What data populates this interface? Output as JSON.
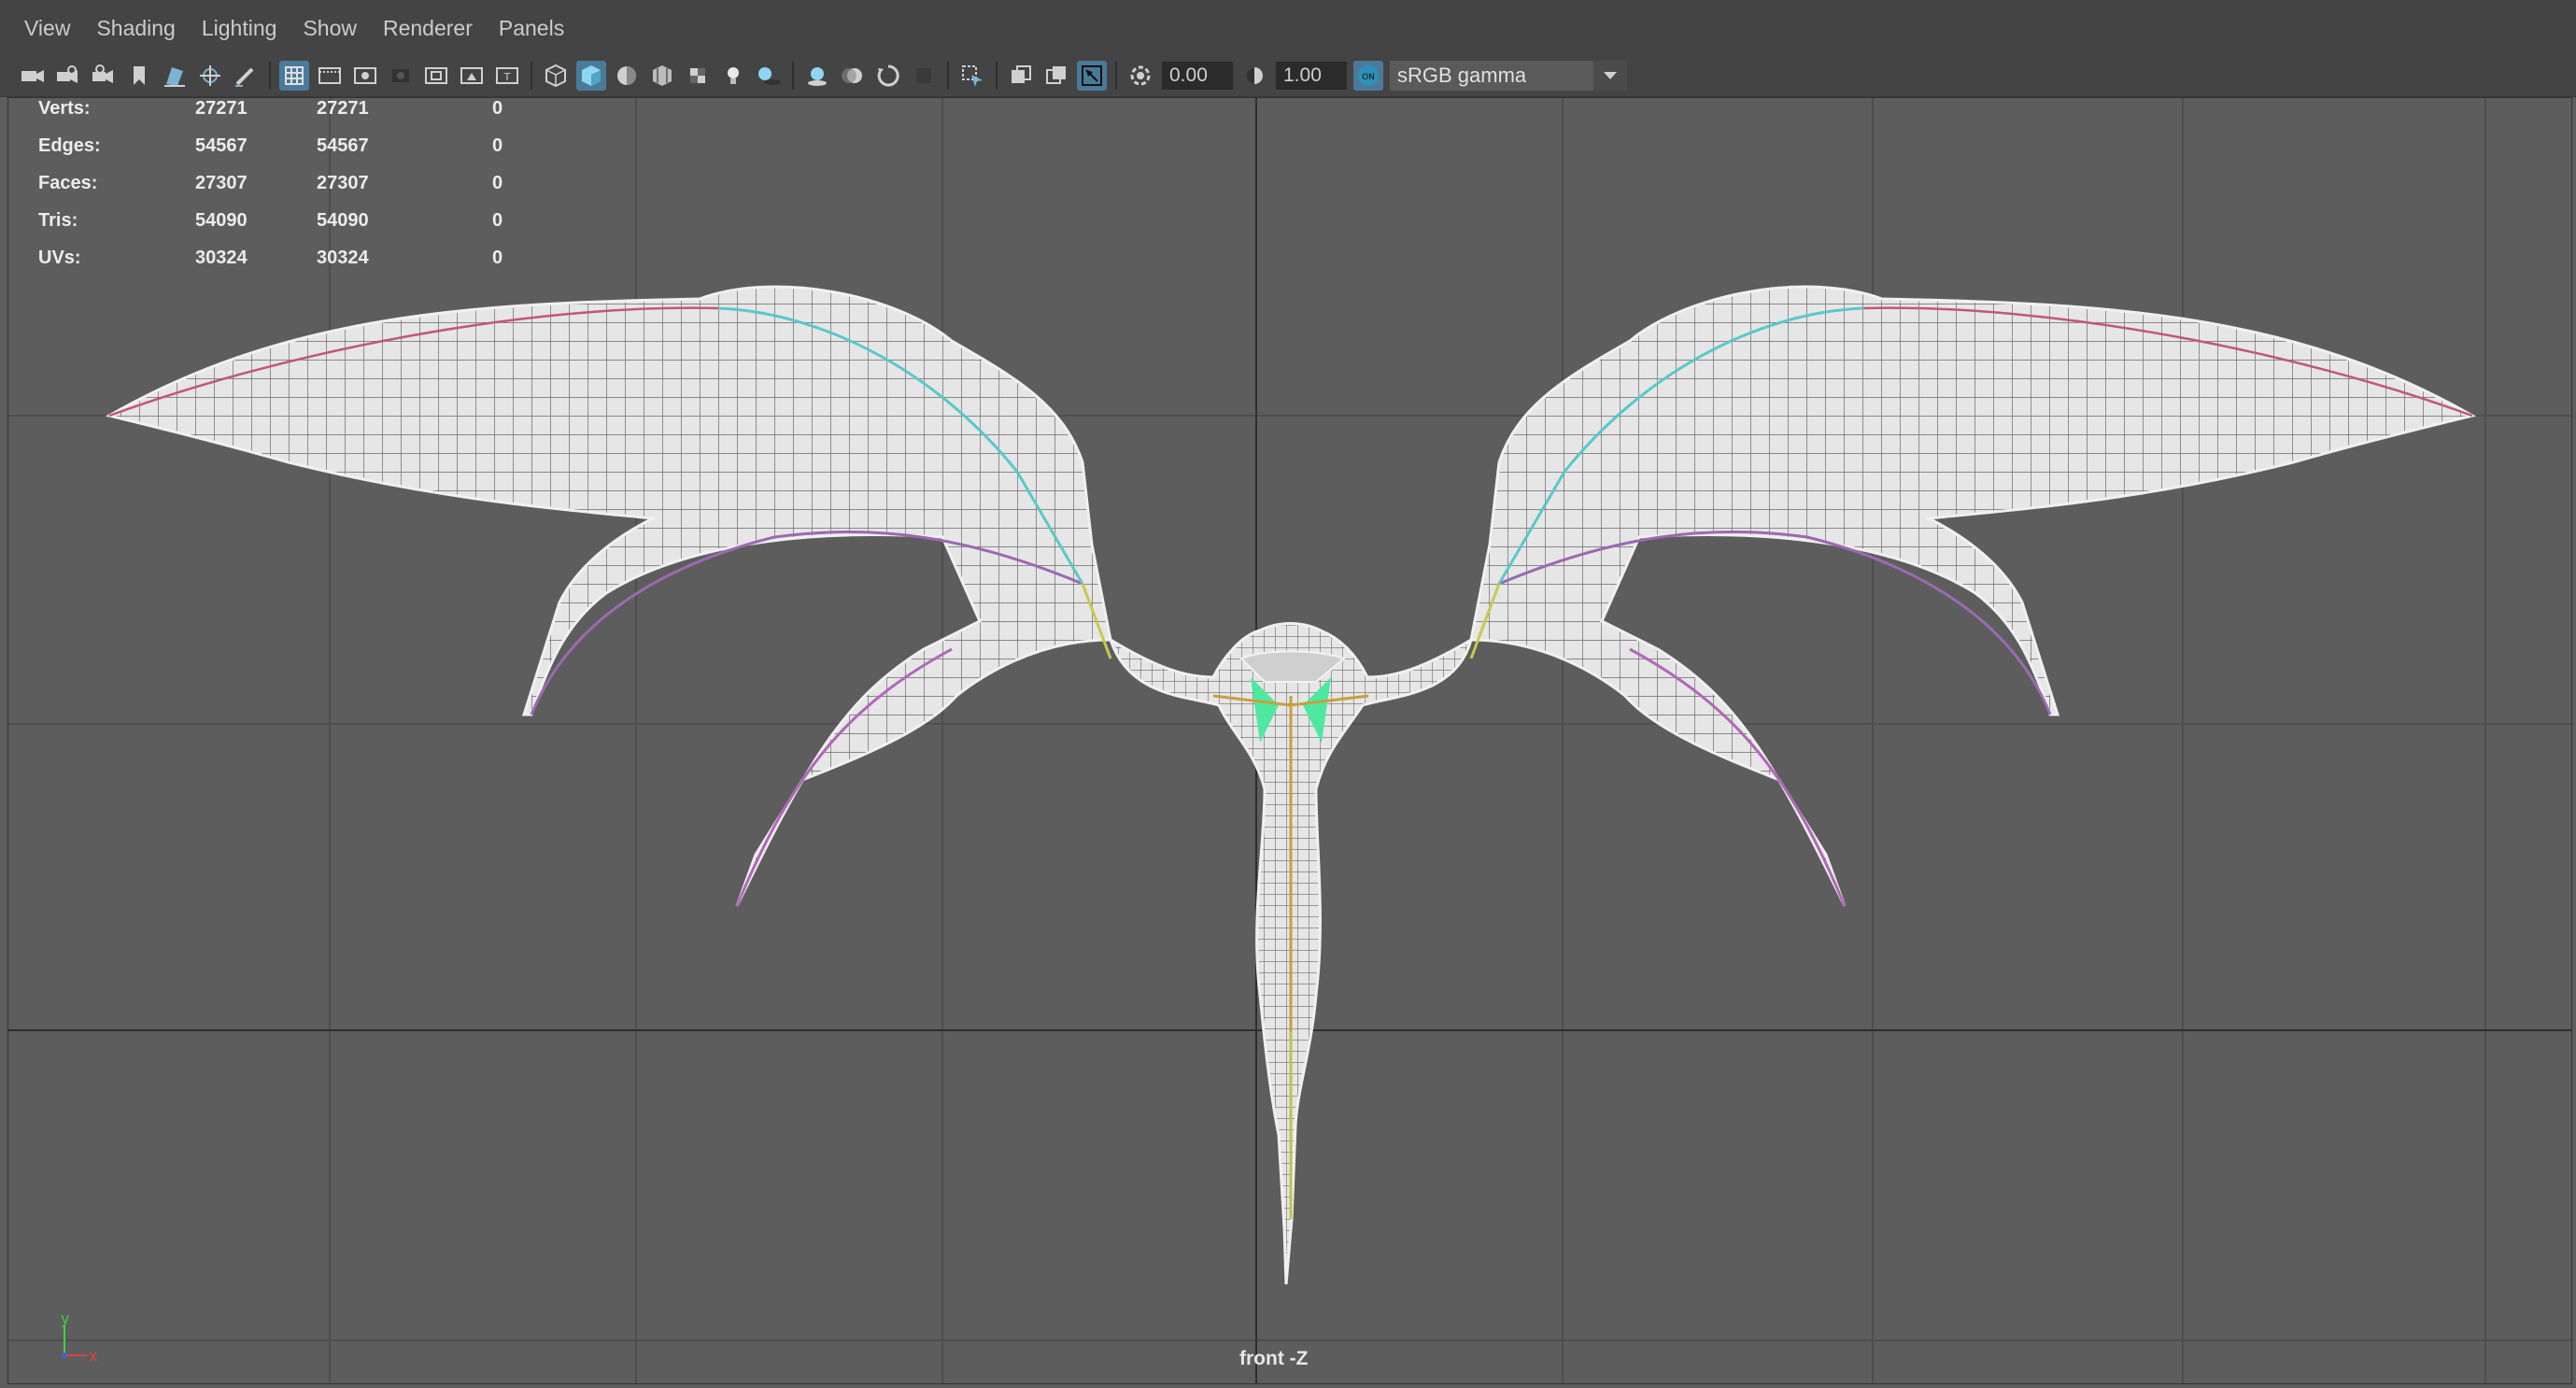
{
  "menu": [
    "View",
    "Shading",
    "Lighting",
    "Show",
    "Renderer",
    "Panels"
  ],
  "toolbar": {
    "exposure_value": "0.00",
    "gamma_value": "1.00",
    "color_space": "sRGB gamma",
    "icons": [
      "camera-icon",
      "camera-attributes-icon",
      "bookmark-icon",
      "image-plane-icon",
      "pan-zoom-icon",
      "grease-pencil-icon",
      "grid-icon",
      "film-gate-icon",
      "resolution-gate-icon",
      "gate-mask-icon",
      "field-chart-icon",
      "safe-action-icon",
      "safe-title-icon",
      "wireframe-icon",
      "smooth-shade-icon",
      "default-material-icon",
      "textured-icon",
      "lights-icon",
      "shadows-icon",
      "screen-space-ao-icon",
      "motion-blur-icon",
      "anti-alias-icon",
      "isolate-select-icon",
      "xray-icon",
      "xray-active-icon",
      "xray-joints-icon",
      "exposure-icon",
      "gamma-icon",
      "color-management-icon"
    ],
    "accent": "#4a7a9a"
  },
  "hud": {
    "rows": [
      {
        "label": "Verts:",
        "total": "27271",
        "selected": "27271",
        "extra": "0"
      },
      {
        "label": "Edges:",
        "total": "54567",
        "selected": "54567",
        "extra": "0"
      },
      {
        "label": "Faces:",
        "total": "27307",
        "selected": "27307",
        "extra": "0"
      },
      {
        "label": "Tris:",
        "total": "54090",
        "selected": "54090",
        "extra": "0"
      },
      {
        "label": "UVs:",
        "total": "30324",
        "selected": "30324",
        "extra": "0"
      }
    ]
  },
  "viewport": {
    "camera_label": "front -Z",
    "background": "#5d5d5d",
    "grid_color": "#4a4a4a",
    "axis_x": "x",
    "axis_y": "y",
    "axis_x_color": "#e04040",
    "axis_y_color": "#40d040",
    "axis_z_color": "#4060e0"
  }
}
